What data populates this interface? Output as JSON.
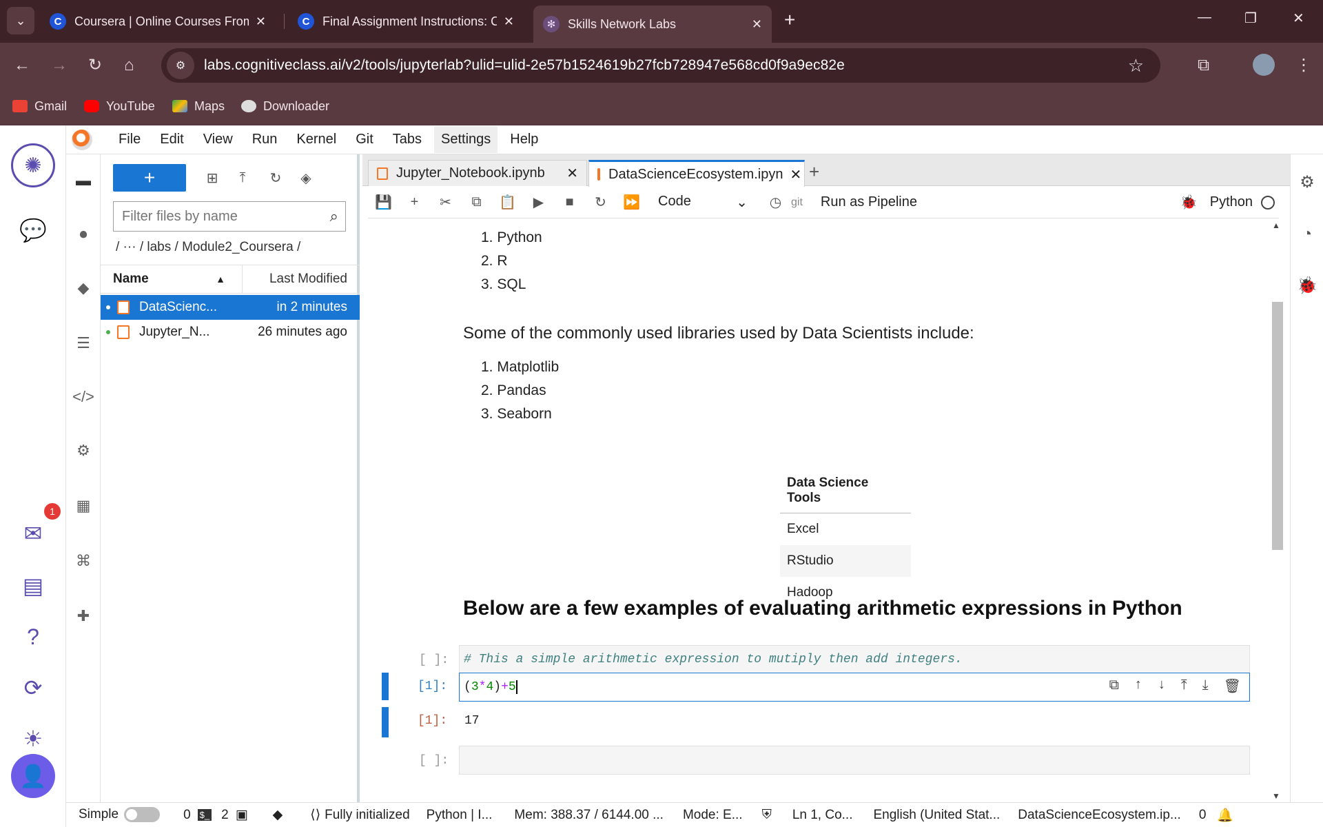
{
  "browser": {
    "tabs": [
      {
        "title": "Coursera | Online Courses From"
      },
      {
        "title": "Final Assignment Instructions: C"
      },
      {
        "title": "Skills Network Labs"
      }
    ],
    "url": "labs.cognitiveclass.ai/v2/tools/jupyterlab?ulid=ulid-2e57b1524619b27fcb728947e568cd0f9a9ec82e",
    "bookmarks": [
      "Gmail",
      "YouTube",
      "Maps",
      "Downloader"
    ]
  },
  "jupyter": {
    "menu": [
      "File",
      "Edit",
      "View",
      "Run",
      "Kernel",
      "Git",
      "Tabs",
      "Settings",
      "Help"
    ],
    "notification_count": "1",
    "filebrowser": {
      "new_label": "+",
      "filter_placeholder": "Filter files by name",
      "breadcrumb": "/ ··· / labs / Module2_Coursera /",
      "col_name": "Name",
      "col_modified": "Last Modified",
      "files": [
        {
          "name": "DataScienc...",
          "modified": "in 2 minutes"
        },
        {
          "name": "Jupyter_N...",
          "modified": "26 minutes ago"
        }
      ]
    },
    "doc_tabs": [
      {
        "title": "Jupyter_Notebook.ipynb"
      },
      {
        "title": "DataScienceEcosystem.ipyn"
      }
    ],
    "toolbar": {
      "cell_type": "Code",
      "git_label": "git",
      "run_pipeline": "Run as Pipeline",
      "kernel": "Python"
    },
    "notebook": {
      "languages": [
        "1. Python",
        "2. R",
        "3. SQL"
      ],
      "libraries_intro": "Some of the commonly used libraries used by Data Scientists include:",
      "libraries": [
        "1. Matplotlib",
        "2. Pandas",
        "3. Seaborn"
      ],
      "table_header": "Data Science Tools",
      "table_rows": [
        "Excel",
        "RStudio",
        "Hadoop"
      ],
      "heading": "Below are a few examples of evaluating arithmetic expressions in Python",
      "cell1_prompt": "[ ]:",
      "cell1_code": "# This a simple arithmetic expression to mutiply then add integers.",
      "cell2_prompt": "[1]:",
      "cell2_code_parts": [
        "(",
        "3",
        "*",
        "4",
        ")",
        "+",
        "5"
      ],
      "output_prompt": "[1]:",
      "output_value": "17",
      "cell3_prompt": "[ ]:"
    },
    "status": {
      "mode_label": "Simple",
      "terminals": "0",
      "kernels": "2",
      "init": "Fully initialized",
      "kernel_status": "Python | I...",
      "mem": "Mem: 388.37 / 6144.00 ...",
      "mode": "Mode: E...",
      "cursor": "Ln 1, Co...",
      "lang": "English (United Stat...",
      "file": "DataScienceEcosystem.ip...",
      "notif_count": "0"
    }
  }
}
